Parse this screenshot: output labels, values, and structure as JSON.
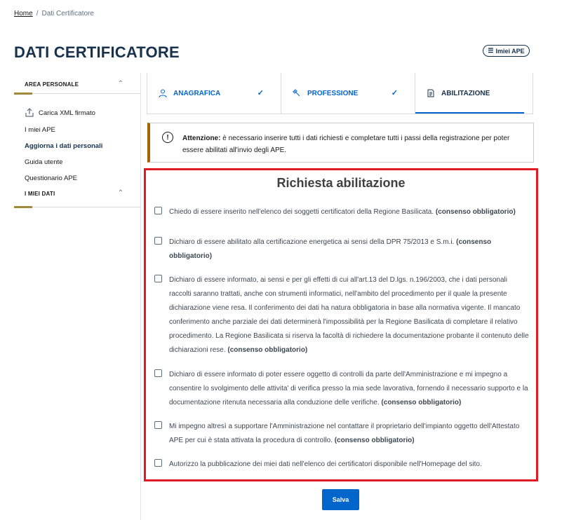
{
  "breadcrumb": {
    "home": "Home",
    "separator": "/",
    "current": "Dati Certificatore"
  },
  "page_title": "DATI CERTIFICATORE",
  "miei_ape_button": {
    "label": "Imiei APE",
    "icon": "list-icon"
  },
  "sidebar": {
    "sections": [
      {
        "label": "AREA PERSONALE",
        "icon": "chevron-up-icon"
      },
      {
        "label": "I MIEI DATI",
        "icon": "chevron-up-icon"
      }
    ],
    "items": [
      {
        "label": "Carica XML firmato",
        "icon": "upload-icon"
      },
      {
        "label": "I miei APE"
      },
      {
        "label": "Aggiorna i dati personali",
        "active": true
      },
      {
        "label": "Guida utente"
      },
      {
        "label": "Questionario APE"
      }
    ]
  },
  "tabs": [
    {
      "label": "ANAGRAFICA",
      "icon": "user-icon",
      "status_icon": "check-icon"
    },
    {
      "label": "PROFESSIONE",
      "icon": "wrench-icon",
      "status_icon": "check-icon"
    },
    {
      "label": "ABILITAZIONE",
      "icon": "document-icon",
      "active": true
    }
  ],
  "alert": {
    "icon": "exclamation-circle-icon",
    "bold": "Attenzione:",
    "text": " è necessario inserire tutti i dati richiesti e completare tutti i passi della registrazione per poter essere abilitati all'invio degli APE."
  },
  "form": {
    "title": "Richiesta abilitazione",
    "required_tag": "(consenso obbligatorio)",
    "items": [
      {
        "text": "Chiedo di essere inserito nell'elenco dei soggetti certificatori della Regione Basilicata. ",
        "required": true,
        "checked": false
      },
      {
        "text": "Dichiaro di essere abilitato alla certificazione energetica ai sensi della DPR 75/2013 e S.m.i. ",
        "required": true,
        "checked": false
      },
      {
        "text": "Dichiaro di essere informato, ai sensi e per gli effetti di cui all'art.13 del D.lgs. n.196/2003, che i dati personali raccolti saranno trattati, anche con strumenti informatici, nell'ambito del procedimento per il quale la presente dichiarazione viene resa. Il conferimento dei dati ha natura obbligatoria in base alla normativa vigente. Il mancato conferimento anche parziale dei dati determinerà l'impossibilità per la Regione Basilicata di completare il relativo procedimento. La Regione Basilicata si riserva la facoltà di richiedere la documentazione probante il contenuto delle dichiarazioni rese. ",
        "required": true,
        "checked": false
      },
      {
        "text": "Dichiaro di essere informato di poter essere oggetto di controlli da parte dell'Amministrazione e mi impegno a consentire lo svolgimento delle attivita' di verifica presso la mia sede lavorativa, fornendo il necessario supporto e la documentazione ritenuta necessaria alla conduzione delle verifiche. ",
        "required": true,
        "checked": false
      },
      {
        "text": "Mi impegno altresì a supportare l'Amministrazione nel contattare il proprietario dell'impianto oggetto dell'Attestato APE per cui è stata attivata la procedura di controllo. ",
        "required": true,
        "checked": false
      },
      {
        "text": "Autorizzo la pubblicazione dei miei dati nell'elenco dei certificatori disponibile nell'Homepage del sito.",
        "required": false,
        "checked": false
      }
    ]
  },
  "save_button": {
    "label": "Salva"
  },
  "colors": {
    "primary": "#0066cc",
    "title": "#17324d",
    "highlight_border": "#e01b24",
    "alert_accent": "#a66300",
    "sidebar_accent": "#a38a3b"
  }
}
